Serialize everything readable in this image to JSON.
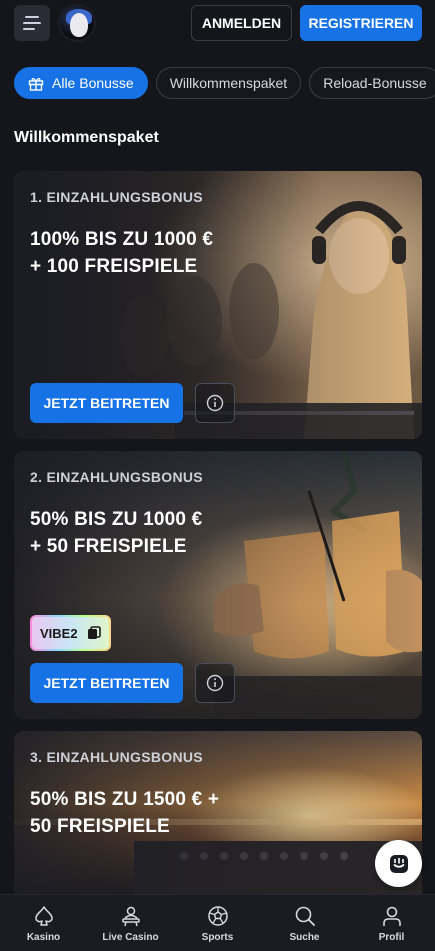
{
  "header": {
    "login_label": "ANMELDEN",
    "register_label": "REGISTRIEREN"
  },
  "tabs": [
    {
      "label": "Alle Bonusse",
      "active": true
    },
    {
      "label": "Willkommenspaket",
      "active": false
    },
    {
      "label": "Reload-Bonusse",
      "active": false
    }
  ],
  "section": {
    "title": "Willkommenspaket"
  },
  "cards": [
    {
      "eyebrow": "1. EINZAHLUNGSBONUS",
      "headline": "100% BIS ZU 1000 €\n+ 100 FREISPIELE",
      "join_label": "JETZT BEITRETEN"
    },
    {
      "eyebrow": "2. EINZAHLUNGSBONUS",
      "headline": "50% BIS ZU 1000 €\n+ 50 FREISPIELE",
      "promo_code": "VIBE2",
      "join_label": "JETZT BEITRETEN"
    },
    {
      "eyebrow": "3. EINZAHLUNGSBONUS",
      "headline": "50% BIS ZU 1500 € +\n50 FREISPIELE"
    }
  ],
  "bottom_nav": [
    {
      "label": "Kasino",
      "icon": "spade-icon"
    },
    {
      "label": "Live Casino",
      "icon": "dealer-icon"
    },
    {
      "label": "Sports",
      "icon": "soccer-ball-icon"
    },
    {
      "label": "Suche",
      "icon": "search-icon"
    },
    {
      "label": "Profil",
      "icon": "user-icon"
    }
  ],
  "colors": {
    "accent": "#1672e5",
    "background": "#15161c",
    "card": "#1c1d24"
  }
}
